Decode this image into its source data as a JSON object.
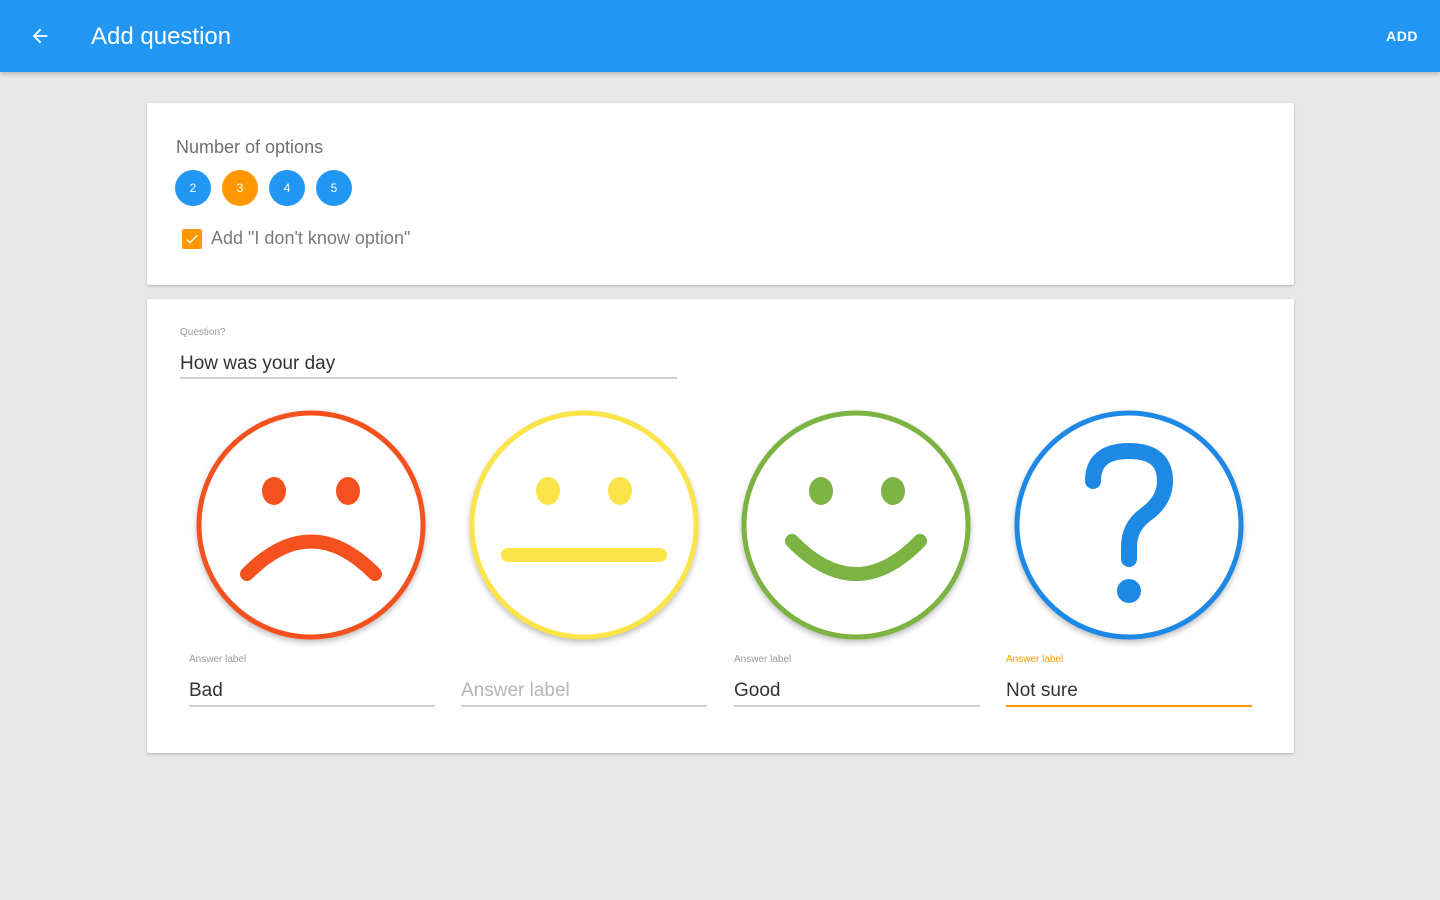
{
  "appbar": {
    "title": "Add question",
    "action_label": "ADD",
    "back_icon": "arrow-left-icon",
    "color": "#2196f3"
  },
  "options": {
    "label": "Number of options",
    "values": [
      "2",
      "3",
      "4",
      "5"
    ],
    "selected": "3",
    "dont_know_label": "Add \"I don't know option\"",
    "dont_know_checked": true
  },
  "question": {
    "label": "Question?",
    "value": "How was your day"
  },
  "answers": [
    {
      "icon": "sad-face-icon",
      "color": "#f4511e",
      "label": "Answer label",
      "value": "Bad",
      "placeholder": "Answer label"
    },
    {
      "icon": "neutral-face-icon",
      "color": "#fbe44a",
      "label": "",
      "value": "",
      "placeholder": "Answer label"
    },
    {
      "icon": "happy-face-icon",
      "color": "#7cb342",
      "label": "Answer label",
      "value": "Good",
      "placeholder": "Answer label"
    },
    {
      "icon": "question-mark-icon",
      "color": "#1e88e5",
      "label": "Answer label",
      "value": "Not sure",
      "placeholder": "Answer label",
      "focused": true
    }
  ],
  "colors": {
    "accent": "#ff9800",
    "primary": "#2196f3"
  }
}
